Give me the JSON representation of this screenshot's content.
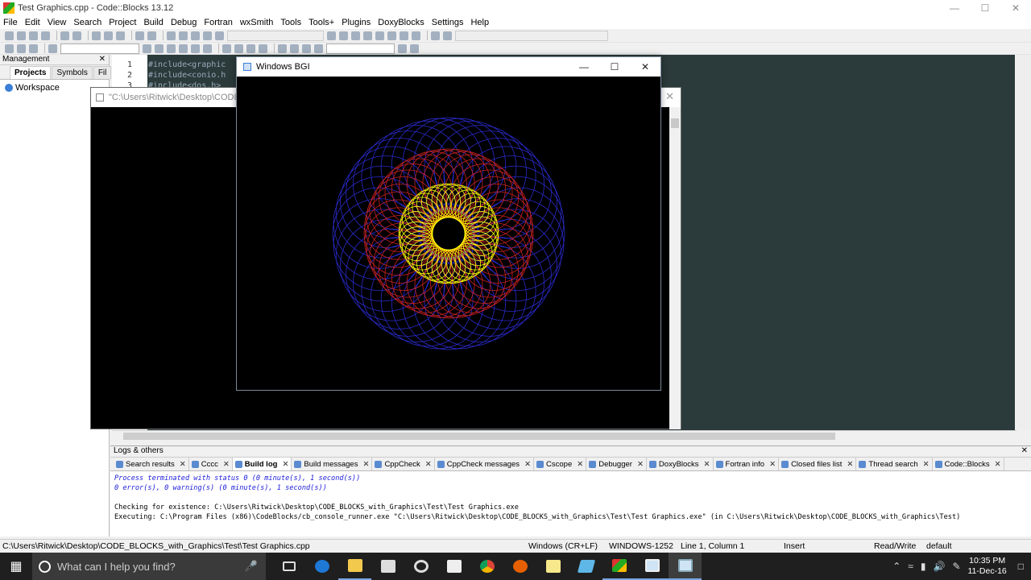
{
  "window": {
    "title": "Test Graphics.cpp - Code::Blocks 13.12"
  },
  "menu": [
    "File",
    "Edit",
    "View",
    "Search",
    "Project",
    "Build",
    "Debug",
    "Fortran",
    "wxSmith",
    "Tools",
    "Tools+",
    "Plugins",
    "DoxyBlocks",
    "Settings",
    "Help"
  ],
  "management": {
    "header": "Management",
    "tabs": [
      "Projects",
      "Symbols",
      "Fil"
    ],
    "workspace": "Workspace"
  },
  "editor": {
    "line_numbers": [
      "1",
      "2",
      "3"
    ],
    "code_lines": [
      "#include<graphic",
      "#include<conio.h",
      "#include<dos.h>"
    ]
  },
  "console": {
    "title": "\"C:\\Users\\Ritwick\\Desktop\\CODE_BL"
  },
  "bgi": {
    "title": "Windows BGI",
    "rings": [
      {
        "color": "#2a2acc",
        "ring_radius": 87,
        "circle_radius": 57,
        "count": 40
      },
      {
        "color": "#cc2222",
        "ring_radius": 63,
        "circle_radius": 42,
        "count": 40
      },
      {
        "color": "#ffff00",
        "ring_radius": 41,
        "circle_radius": 21,
        "count": 40
      }
    ]
  },
  "logs": {
    "header": "Logs & others",
    "tabs": [
      "Search results",
      "Cccc",
      "Build log",
      "Build messages",
      "CppCheck",
      "CppCheck messages",
      "Cscope",
      "Debugger",
      "DoxyBlocks",
      "Fortran info",
      "Closed files list",
      "Thread search",
      "Code::Blocks"
    ],
    "active_tab": "Build log",
    "lines": [
      "Process terminated with status 0 (0 minute(s), 1 second(s))",
      "0 error(s), 0 warning(s) (0 minute(s), 1 second(s))",
      "",
      "Checking for existence: C:\\Users\\Ritwick\\Desktop\\CODE_BLOCKS_with_Graphics\\Test\\Test Graphics.exe",
      "Executing: C:\\Program Files (x86)\\CodeBlocks/cb_console_runner.exe \"C:\\Users\\Ritwick\\Desktop\\CODE_BLOCKS_with_Graphics\\Test\\Test Graphics.exe\" (in C:\\Users\\Ritwick\\Desktop\\CODE_BLOCKS_with_Graphics\\Test)"
    ]
  },
  "status": {
    "path": "C:\\Users\\Ritwick\\Desktop\\CODE_BLOCKS_with_Graphics\\Test\\Test Graphics.cpp",
    "eol": "Windows (CR+LF)",
    "encoding": "WINDOWS-1252",
    "position": "Line 1, Column 1",
    "mode": "Insert",
    "access": "Read/Write",
    "profile": "default"
  },
  "taskbar": {
    "search_placeholder": "What can I help you find?",
    "time": "10:35 PM",
    "date": "11-Dec-16"
  }
}
